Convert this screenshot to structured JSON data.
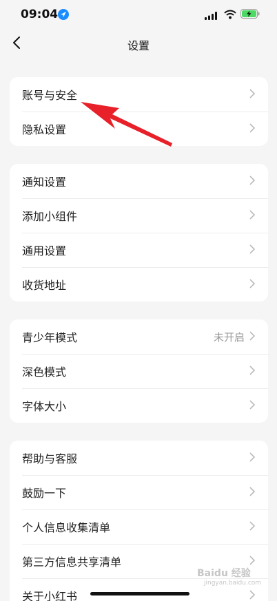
{
  "status_bar": {
    "time": "09:04",
    "icons": [
      "location-arrow-icon",
      "signal-icon",
      "wifi-icon",
      "battery-charging-icon"
    ]
  },
  "nav": {
    "title": "设置",
    "back_icon": "chevron-left-icon"
  },
  "groups": [
    {
      "items": [
        {
          "label": "账号与安全"
        },
        {
          "label": "隐私设置"
        }
      ]
    },
    {
      "items": [
        {
          "label": "通知设置"
        },
        {
          "label": "添加小组件"
        },
        {
          "label": "通用设置"
        },
        {
          "label": "收货地址"
        }
      ]
    },
    {
      "items": [
        {
          "label": "青少年模式",
          "value": "未开启"
        },
        {
          "label": "深色模式"
        },
        {
          "label": "字体大小"
        }
      ]
    },
    {
      "items": [
        {
          "label": "帮助与客服"
        },
        {
          "label": "鼓励一下"
        },
        {
          "label": "个人信息收集清单"
        },
        {
          "label": "第三方信息共享清单"
        },
        {
          "label": "关于小红书"
        }
      ]
    }
  ],
  "annotation": {
    "color": "#e8202a",
    "points_to": "账号与安全"
  },
  "watermark": {
    "brand": "Baidu 经验",
    "sub": "jingyan.baidu.com"
  },
  "colors": {
    "background": "#f5f5f5",
    "card": "#ffffff",
    "text": "#222222",
    "secondary": "#999999",
    "battery": "#4cd964"
  }
}
